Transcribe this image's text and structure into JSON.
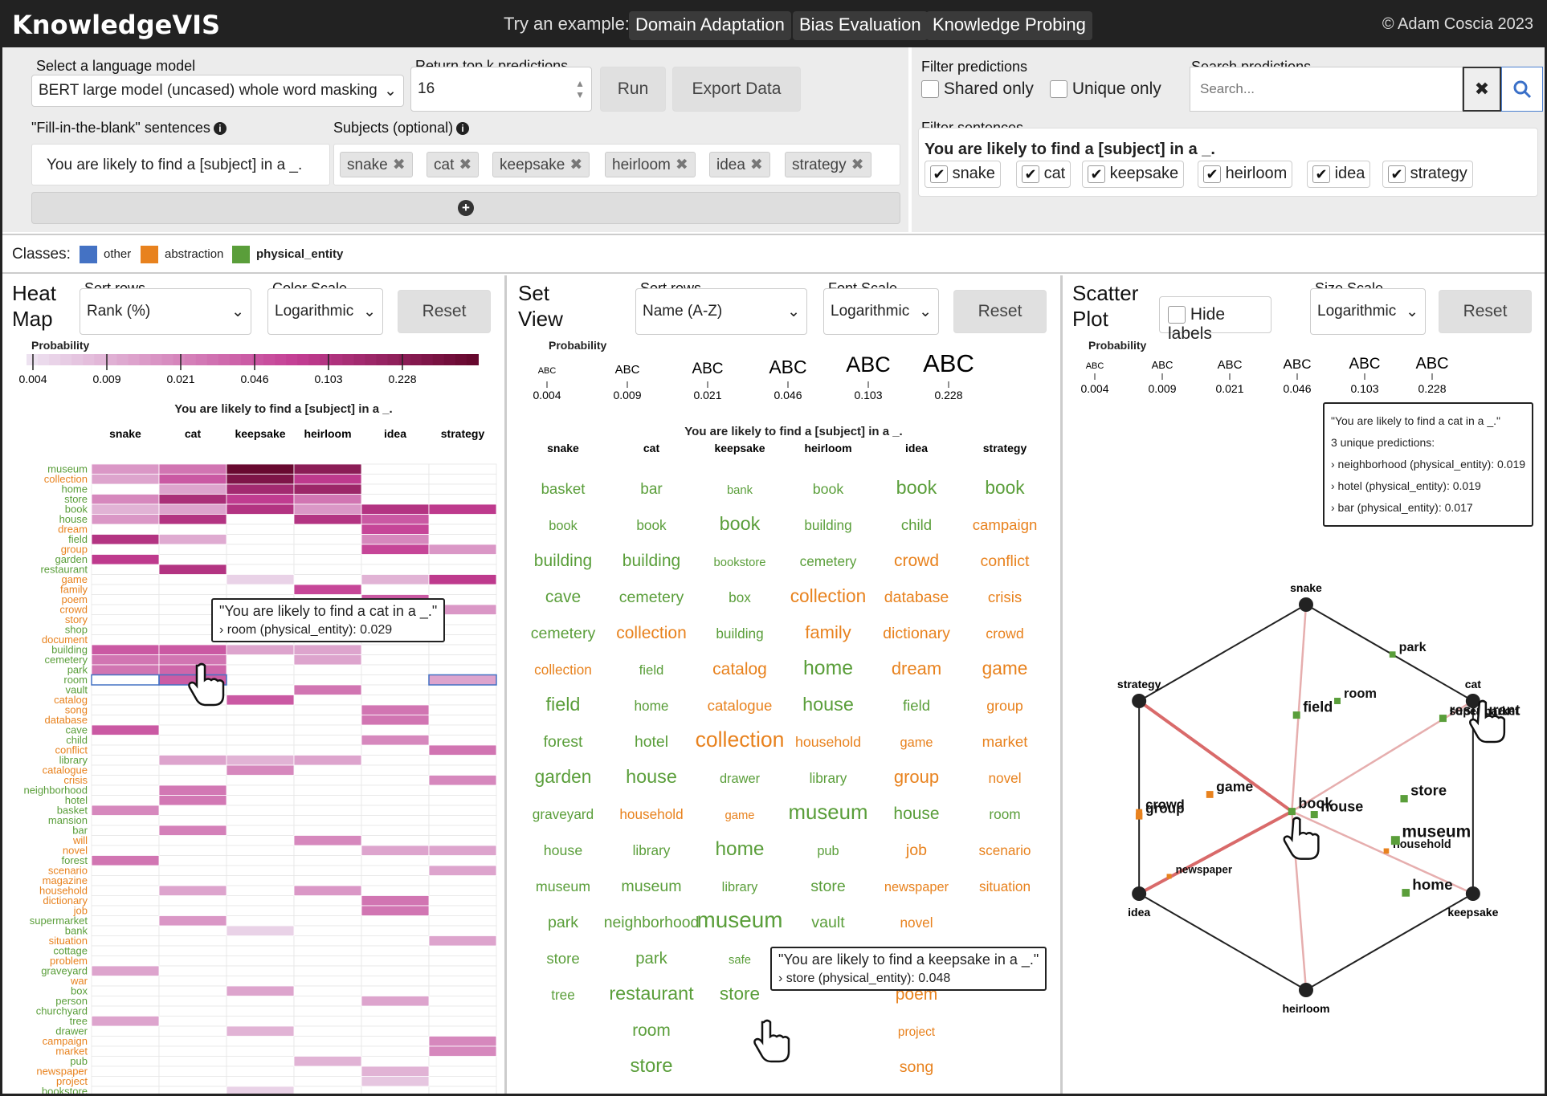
{
  "app": {
    "title": "KnowledgeVIS",
    "examples_label": "Try an example:",
    "examples": [
      "Domain Adaptation",
      "Bias Evaluation",
      "Knowledge Probing"
    ],
    "copyright": "© Adam Coscia  2023"
  },
  "controls": {
    "model_label": "Select a language model",
    "model_value": "BERT large model (uncased) whole word masking",
    "topk_label": "Return top k predictions",
    "topk_value": "16",
    "run_label": "Run",
    "export_label": "Export Data",
    "sentences_label": "\"Fill-in-the-blank\" sentences",
    "sentence_value": "You are likely to find a [subject] in a _.",
    "subjects_label": "Subjects (optional)",
    "subjects": [
      "snake",
      "cat",
      "keepsake",
      "heirloom",
      "idea",
      "strategy"
    ],
    "add_icon": "plus-circle-icon"
  },
  "filters": {
    "predictions_label": "Filter predictions",
    "shared_label": "Shared only",
    "unique_label": "Unique only",
    "search_label": "Search predictions",
    "search_placeholder": "Search...",
    "sentences_label": "Filter sentences",
    "sentence": "You are likely to find a [subject] in a _."
  },
  "classes": {
    "label": "Classes:",
    "items": [
      {
        "name": "other",
        "color": "#4472c4"
      },
      {
        "name": "abstraction",
        "color": "#e8821e"
      },
      {
        "name": "physical_entity",
        "color": "#5a9e3a"
      }
    ]
  },
  "heatmap": {
    "title": "Heat Map",
    "sort_label": "Sort rows",
    "sort_value": "Rank (%)",
    "color_label": "Color Scale",
    "color_value": "Logarithmic",
    "reset": "Reset",
    "prob_label": "Probability",
    "ticks": [
      "0.004",
      "0.009",
      "0.021",
      "0.046",
      "0.103",
      "0.228"
    ],
    "chart_title": "You are likely to find a [subject] in a _.",
    "tooltip_title": "\"You are likely to find a cat in a _.\"",
    "tooltip_line": "› room (physical_entity): 0.029"
  },
  "setview": {
    "title": "Set View",
    "sort_label": "Sort rows",
    "sort_value": "Name (A-Z)",
    "font_label": "Font Scale",
    "font_value": "Logarithmic",
    "reset": "Reset",
    "prob_label": "Probability",
    "scale_word": "ABC",
    "chart_title": "You are likely to find a [subject] in a _.",
    "tooltip_title": "\"You are likely to find a keepsake in a _.\"",
    "tooltip_line": "› store (physical_entity): 0.048"
  },
  "scatter": {
    "title": "Scatter Plot",
    "hide_labels": "Hide labels",
    "size_label": "Size Scale",
    "size_value": "Logarithmic",
    "reset": "Reset",
    "prob_label": "Probability",
    "tooltip_title": "\"You are likely to find a cat in a _.\"",
    "tooltip_sub": "3 unique predictions:",
    "tooltip_lines": [
      "› neighborhood (physical_entity): 0.019",
      "› hotel (physical_entity): 0.019",
      "› bar (physical_entity): 0.017"
    ]
  },
  "chart_data": {
    "type": "heatmap",
    "title": "You are likely to find a [subject] in a _.",
    "columns": [
      "snake",
      "cat",
      "keepsake",
      "heirloom",
      "idea",
      "strategy"
    ],
    "rows": [
      "museum",
      "collection",
      "home",
      "store",
      "book",
      "house",
      "dream",
      "field",
      "group",
      "garden",
      "restaurant",
      "game",
      "family",
      "poem",
      "crowd",
      "story",
      "shop",
      "document",
      "building",
      "cemetery",
      "park",
      "room",
      "vault",
      "catalog",
      "song",
      "database",
      "cave",
      "child",
      "conflict",
      "library",
      "catalogue",
      "crisis",
      "neighborhood",
      "hotel",
      "basket",
      "mansion",
      "bar",
      "will",
      "novel",
      "forest",
      "scenario",
      "magazine",
      "household",
      "dictionary",
      "job",
      "supermarket",
      "bank",
      "situation",
      "cottage",
      "problem",
      "graveyard",
      "war",
      "box",
      "person",
      "churchyard",
      "tree",
      "drawer",
      "campaign",
      "market",
      "pub",
      "newspaper",
      "project",
      "bookstore",
      "safe"
    ],
    "row_classes": [
      "p",
      "a",
      "p",
      "p",
      "p",
      "p",
      "a",
      "p",
      "a",
      "p",
      "p",
      "a",
      "a",
      "a",
      "a",
      "a",
      "p",
      "a",
      "p",
      "p",
      "p",
      "p",
      "p",
      "a",
      "a",
      "a",
      "p",
      "p",
      "a",
      "p",
      "a",
      "a",
      "p",
      "p",
      "p",
      "p",
      "p",
      "a",
      "a",
      "p",
      "a",
      "a",
      "a",
      "a",
      "a",
      "p",
      "p",
      "a",
      "p",
      "a",
      "p",
      "a",
      "p",
      "p",
      "p",
      "p",
      "p",
      "a",
      "a",
      "p",
      "a",
      "a",
      "p",
      "p"
    ],
    "cells": [
      [
        "museum",
        "snake",
        0.012
      ],
      [
        "museum",
        "cat",
        0.02
      ],
      [
        "museum",
        "keepsake",
        0.22
      ],
      [
        "museum",
        "heirloom",
        0.12
      ],
      [
        "collection",
        "snake",
        0.01
      ],
      [
        "collection",
        "cat",
        0.03
      ],
      [
        "collection",
        "keepsake",
        0.15
      ],
      [
        "collection",
        "heirloom",
        0.05
      ],
      [
        "home",
        "cat",
        0.01
      ],
      [
        "home",
        "keepsake",
        0.08
      ],
      [
        "home",
        "heirloom",
        0.09
      ],
      [
        "store",
        "snake",
        0.015
      ],
      [
        "store",
        "cat",
        0.07
      ],
      [
        "store",
        "keepsake",
        0.048
      ],
      [
        "store",
        "heirloom",
        0.02
      ],
      [
        "book",
        "snake",
        0.008
      ],
      [
        "book",
        "cat",
        0.01
      ],
      [
        "book",
        "keepsake",
        0.06
      ],
      [
        "book",
        "heirloom",
        0.012
      ],
      [
        "book",
        "idea",
        0.06
      ],
      [
        "book",
        "strategy",
        0.05
      ],
      [
        "house",
        "snake",
        0.012
      ],
      [
        "house",
        "cat",
        0.06
      ],
      [
        "house",
        "heirloom",
        0.06
      ],
      [
        "house",
        "idea",
        0.03
      ],
      [
        "dream",
        "idea",
        0.04
      ],
      [
        "field",
        "snake",
        0.06
      ],
      [
        "field",
        "cat",
        0.009
      ],
      [
        "field",
        "idea",
        0.015
      ],
      [
        "group",
        "idea",
        0.04
      ],
      [
        "group",
        "strategy",
        0.012
      ],
      [
        "garden",
        "snake",
        0.05
      ],
      [
        "restaurant",
        "cat",
        0.06
      ],
      [
        "game",
        "keepsake",
        0.005
      ],
      [
        "game",
        "idea",
        0.008
      ],
      [
        "game",
        "strategy",
        0.05
      ],
      [
        "family",
        "heirloom",
        0.04
      ],
      [
        "poem",
        "idea",
        0.03
      ],
      [
        "crowd",
        "idea",
        0.03
      ],
      [
        "crowd",
        "strategy",
        0.012
      ],
      [
        "story",
        "idea",
        0.009
      ],
      [
        "building",
        "snake",
        0.03
      ],
      [
        "building",
        "cat",
        0.03
      ],
      [
        "building",
        "keepsake",
        0.01
      ],
      [
        "building",
        "heirloom",
        0.01
      ],
      [
        "cemetery",
        "snake",
        0.02
      ],
      [
        "cemetery",
        "cat",
        0.02
      ],
      [
        "cemetery",
        "heirloom",
        0.01
      ],
      [
        "park",
        "snake",
        0.02
      ],
      [
        "park",
        "cat",
        0.025
      ],
      [
        "room",
        "cat",
        0.029
      ],
      [
        "room",
        "strategy",
        0.01
      ],
      [
        "vault",
        "heirloom",
        0.02
      ],
      [
        "catalog",
        "keepsake",
        0.03
      ],
      [
        "song",
        "idea",
        0.02
      ],
      [
        "database",
        "idea",
        0.02
      ],
      [
        "cave",
        "snake",
        0.03
      ],
      [
        "child",
        "idea",
        0.015
      ],
      [
        "conflict",
        "strategy",
        0.02
      ],
      [
        "library",
        "cat",
        0.01
      ],
      [
        "library",
        "keepsake",
        0.008
      ],
      [
        "library",
        "heirloom",
        0.01
      ],
      [
        "catalogue",
        "keepsake",
        0.015
      ],
      [
        "crisis",
        "strategy",
        0.015
      ],
      [
        "neighborhood",
        "cat",
        0.019
      ],
      [
        "hotel",
        "cat",
        0.019
      ],
      [
        "basket",
        "snake",
        0.015
      ],
      [
        "bar",
        "cat",
        0.017
      ],
      [
        "will",
        "heirloom",
        0.015
      ],
      [
        "novel",
        "idea",
        0.01
      ],
      [
        "novel",
        "strategy",
        0.01
      ],
      [
        "forest",
        "snake",
        0.02
      ],
      [
        "scenario",
        "strategy",
        0.01
      ],
      [
        "household",
        "cat",
        0.01
      ],
      [
        "household",
        "heirloom",
        0.012
      ],
      [
        "dictionary",
        "idea",
        0.02
      ],
      [
        "job",
        "idea",
        0.02
      ],
      [
        "supermarket",
        "cat",
        0.012
      ],
      [
        "bank",
        "keepsake",
        0.005
      ],
      [
        "situation",
        "strategy",
        0.01
      ],
      [
        "graveyard",
        "snake",
        0.01
      ],
      [
        "box",
        "keepsake",
        0.01
      ],
      [
        "person",
        "idea",
        0.01
      ],
      [
        "tree",
        "snake",
        0.01
      ],
      [
        "drawer",
        "keepsake",
        0.008
      ],
      [
        "campaign",
        "strategy",
        0.015
      ],
      [
        "market",
        "strategy",
        0.015
      ],
      [
        "pub",
        "heirloom",
        0.008
      ],
      [
        "newspaper",
        "idea",
        0.008
      ],
      [
        "project",
        "idea",
        0.006
      ],
      [
        "bookstore",
        "keepsake",
        0.005
      ],
      [
        "safe",
        "keepsake",
        0.005
      ]
    ]
  }
}
